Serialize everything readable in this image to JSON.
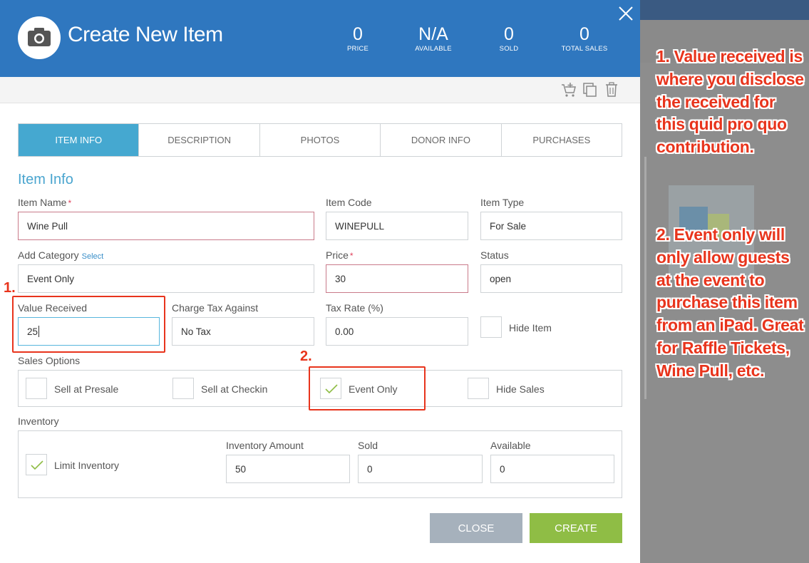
{
  "header": {
    "title": "Create New Item",
    "stats": [
      {
        "value": "0",
        "label": "PRICE"
      },
      {
        "value": "N/A",
        "label": "AVAILABLE"
      },
      {
        "value": "0",
        "label": "SOLD"
      },
      {
        "value": "0",
        "label": "TOTAL SALES"
      }
    ]
  },
  "tabs": [
    {
      "label": "ITEM INFO",
      "active": true
    },
    {
      "label": "DESCRIPTION",
      "active": false
    },
    {
      "label": "PHOTOS",
      "active": false
    },
    {
      "label": "DONOR INFO",
      "active": false
    },
    {
      "label": "PURCHASES",
      "active": false
    }
  ],
  "section_title": "Item Info",
  "fields": {
    "item_name": {
      "label": "Item Name",
      "required": "*",
      "value": "Wine Pull"
    },
    "item_code": {
      "label": "Item Code",
      "value": "WINEPULL"
    },
    "item_type": {
      "label": "Item Type",
      "value": "For Sale"
    },
    "add_category": {
      "label": "Add Category",
      "link": "Select",
      "value": "Event Only"
    },
    "price": {
      "label": "Price",
      "required": "*",
      "value": "30"
    },
    "status": {
      "label": "Status",
      "value": "open"
    },
    "value_received": {
      "label": "Value Received",
      "value": "25"
    },
    "charge_tax": {
      "label": "Charge Tax Against",
      "value": "No Tax"
    },
    "tax_rate": {
      "label": "Tax Rate (%)",
      "value": "0.00"
    },
    "hide_item": {
      "label": "Hide Item",
      "checked": false
    }
  },
  "sales_options": {
    "label": "Sales Options",
    "options": [
      {
        "label": "Sell at Presale",
        "checked": false
      },
      {
        "label": "Sell at Checkin",
        "checked": false
      },
      {
        "label": "Event Only",
        "checked": true
      },
      {
        "label": "Hide Sales",
        "checked": false
      }
    ]
  },
  "inventory": {
    "label": "Inventory",
    "limit_label": "Limit Inventory",
    "limit_checked": true,
    "amount": {
      "label": "Inventory Amount",
      "value": "50"
    },
    "sold": {
      "label": "Sold",
      "value": "0"
    },
    "available": {
      "label": "Available",
      "value": "0"
    }
  },
  "buttons": {
    "close": "CLOSE",
    "create": "CREATE"
  },
  "callouts": {
    "one": "1.",
    "two": "2."
  },
  "annotations": {
    "note1": "1. Value received is where you disclose the received for this quid pro quo contribution.",
    "note2": "2. Event only will only allow guests at the event to purchase this item from an iPad. Great for Raffle Tickets, Wine Pull, etc."
  },
  "colors": {
    "header_blue": "#2f77bf",
    "active_tab": "#45a8d0",
    "create_green": "#8fbd45",
    "close_gray": "#a6b1bc",
    "annotation_red": "#e8341c"
  }
}
